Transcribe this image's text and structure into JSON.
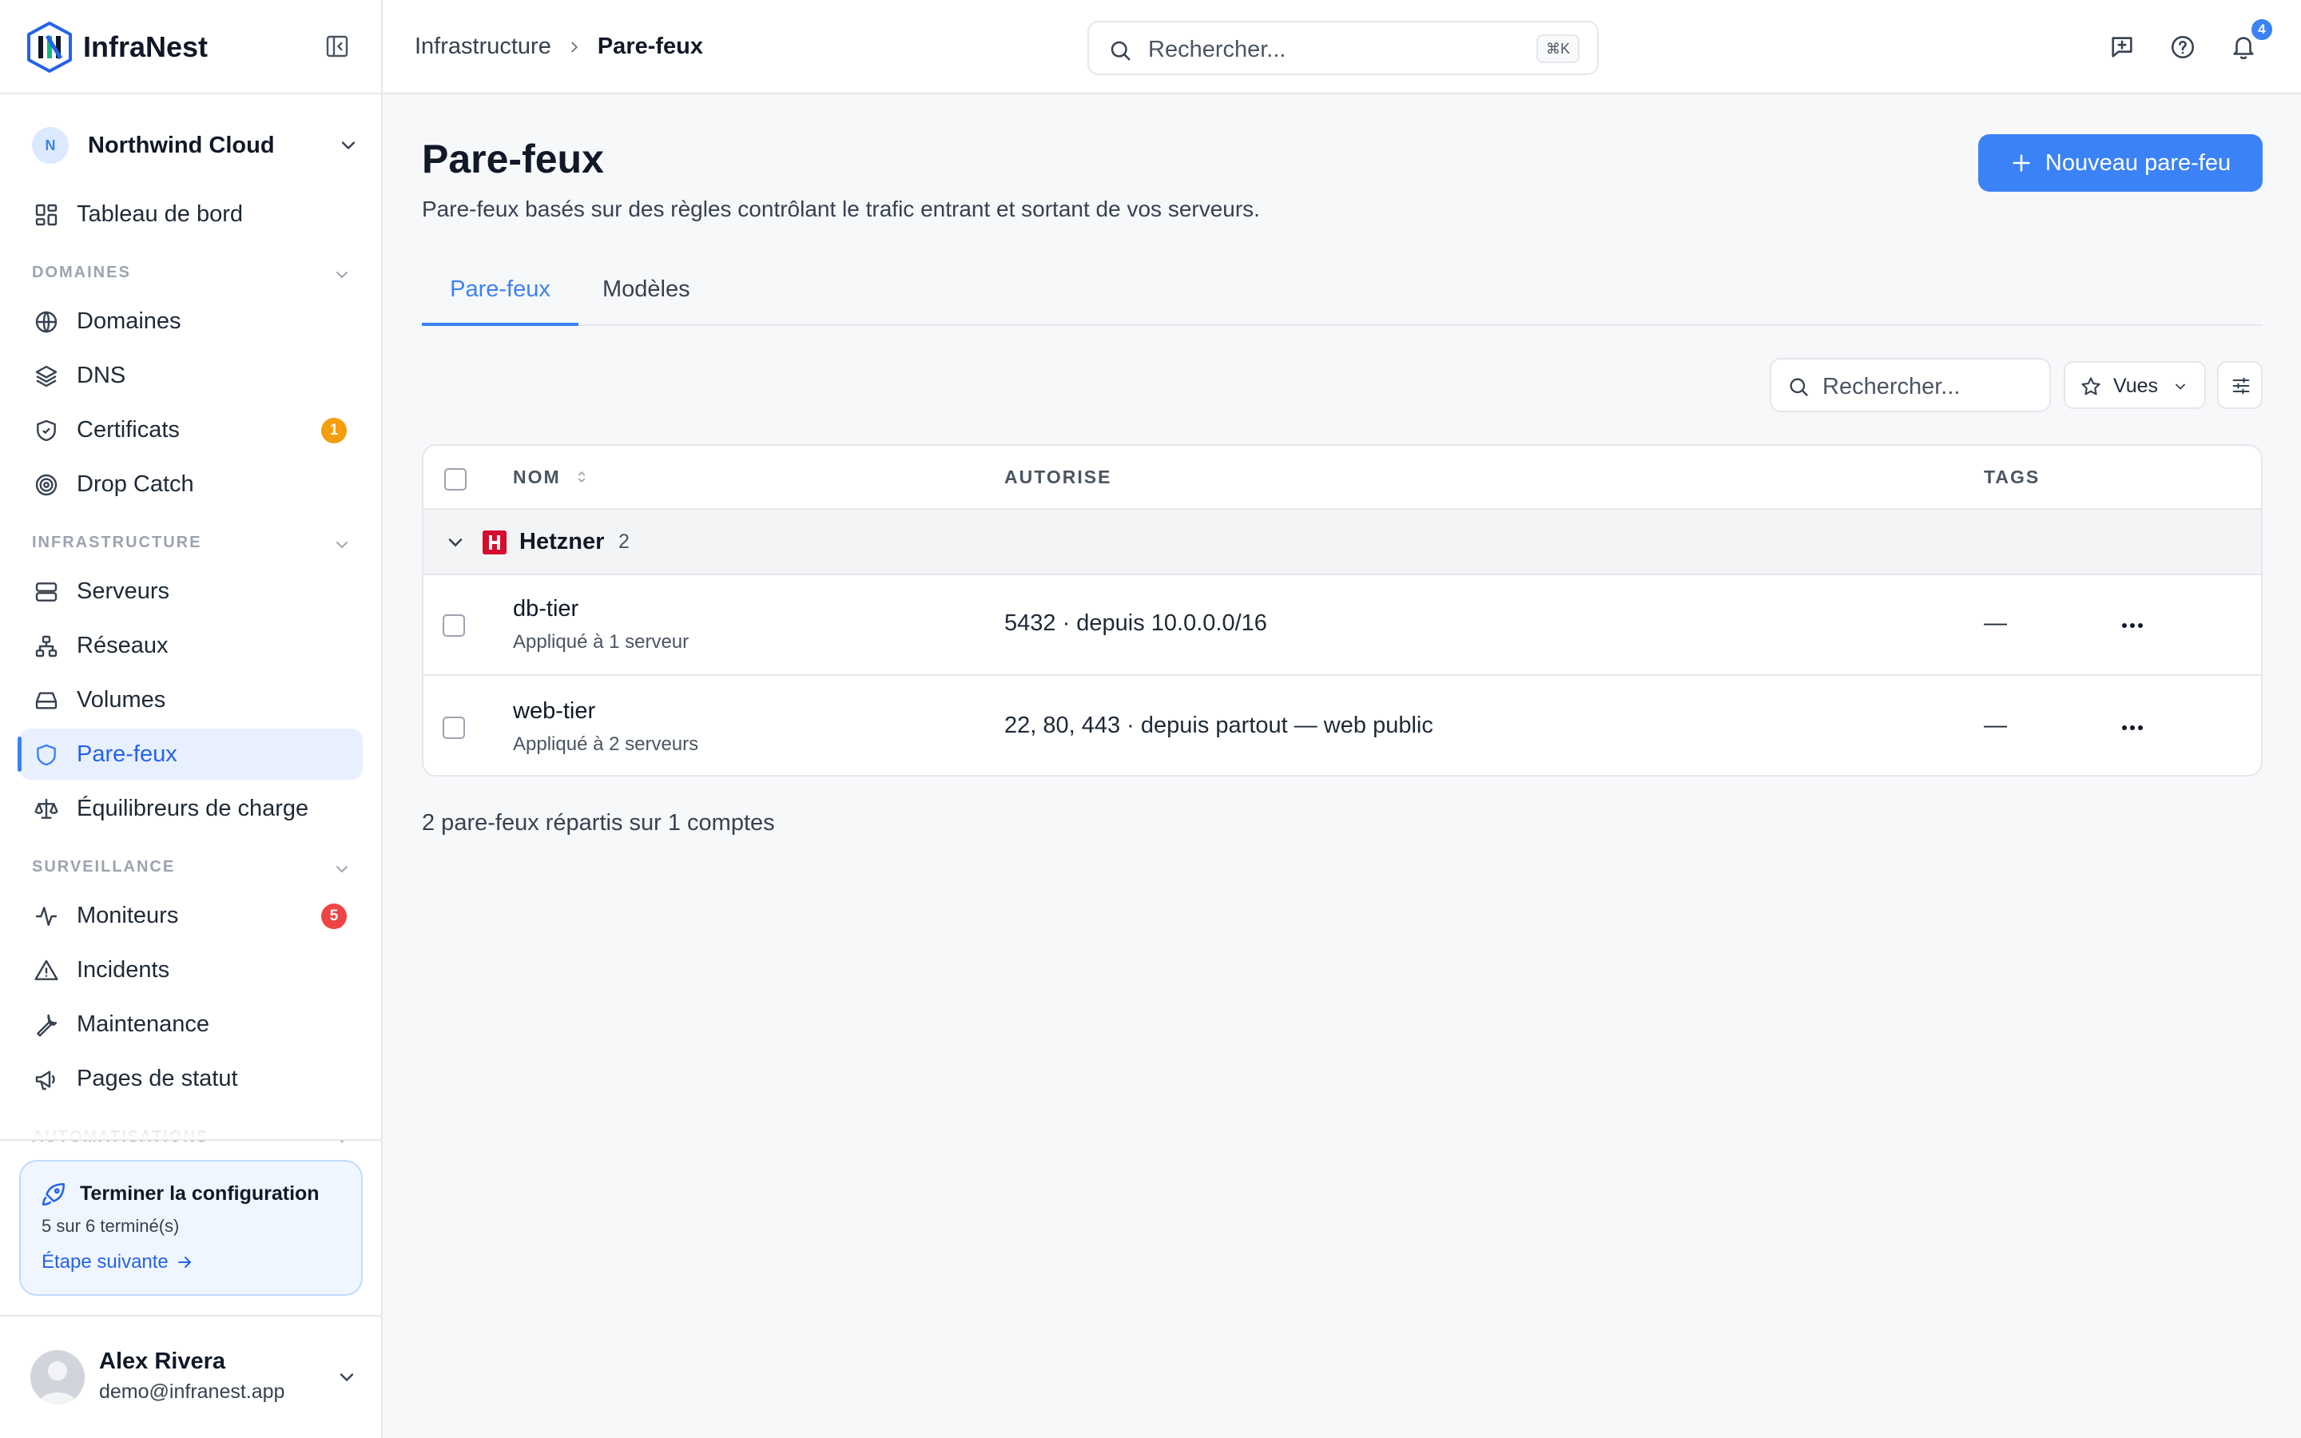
{
  "brand": {
    "name": "InfraNest"
  },
  "org": {
    "initial": "N",
    "name": "Northwind Cloud"
  },
  "nav": {
    "dashboard": "Tableau de bord",
    "sections": {
      "domains": "DOMAINES",
      "infrastructure": "INFRASTRUCTURE",
      "monitoring": "SURVEILLANCE",
      "automations": "AUTOMATISATIONS"
    },
    "domains_items": [
      {
        "label": "Domaines",
        "icon": "globe-icon"
      },
      {
        "label": "DNS",
        "icon": "layers-icon"
      },
      {
        "label": "Certificats",
        "icon": "shield-check-icon",
        "badge": "1"
      },
      {
        "label": "Drop Catch",
        "icon": "target-icon"
      }
    ],
    "infra_items": [
      {
        "label": "Serveurs",
        "icon": "server-icon"
      },
      {
        "label": "Réseaux",
        "icon": "network-icon"
      },
      {
        "label": "Volumes",
        "icon": "drive-icon"
      },
      {
        "label": "Pare-feux",
        "icon": "shield-icon",
        "active": true
      },
      {
        "label": "Équilibreurs de charge",
        "icon": "scale-icon"
      }
    ],
    "monitoring_items": [
      {
        "label": "Moniteurs",
        "icon": "activity-icon",
        "badge": "5"
      },
      {
        "label": "Incidents",
        "icon": "alert-triangle-icon"
      },
      {
        "label": "Maintenance",
        "icon": "wrench-icon"
      },
      {
        "label": "Pages de statut",
        "icon": "megaphone-icon"
      }
    ]
  },
  "setup": {
    "title": "Terminer la configuration",
    "progress": "5 sur 6 terminé(s)",
    "progress_done": 5,
    "progress_total": 6,
    "link": "Étape suivante"
  },
  "user": {
    "name": "Alex Rivera",
    "email": "demo@infranest.app"
  },
  "topbar": {
    "breadcrumb": [
      "Infrastructure",
      "Pare-feux"
    ],
    "search_placeholder": "Rechercher...",
    "shortcut": "⌘K",
    "notifications_count": "4"
  },
  "page": {
    "title": "Pare-feux",
    "description": "Pare-feux basés sur des règles contrôlant le trafic entrant et sortant de vos serveurs.",
    "new_button": "Nouveau pare-feu",
    "tabs": [
      "Pare-feux",
      "Modèles"
    ],
    "active_tab": 0,
    "search_placeholder": "Rechercher...",
    "views_label": "Vues"
  },
  "table": {
    "columns": {
      "name": "NOM",
      "allowed": "AUTORISE",
      "tags": "TAGS"
    },
    "group": {
      "name": "Hetzner",
      "logo_letter": "H",
      "count": "2",
      "color": "#d50c2d"
    },
    "rows": [
      {
        "name": "db-tier",
        "applied": "Appliqué à 1 serveur",
        "allowed": "5432 · depuis 10.0.0.0/16",
        "tags": "—"
      },
      {
        "name": "web-tier",
        "applied": "Appliqué à 2 serveurs",
        "allowed": "22, 80, 443 · depuis partout — web public",
        "tags": "—"
      }
    ]
  },
  "footer": {
    "summary": "2 pare-feux répartis sur 1 comptes"
  },
  "colors": {
    "accent": "#3b82f6",
    "badge_orange": "#f59e0b",
    "badge_red": "#ef4444"
  }
}
